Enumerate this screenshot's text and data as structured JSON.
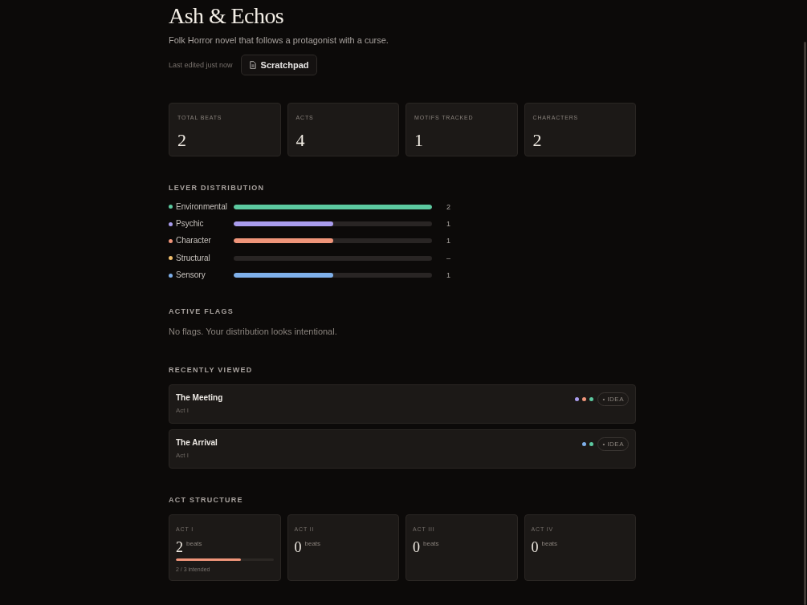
{
  "project": {
    "title": "Ash & Echos",
    "description": "Folk Horror novel that follows a protagonist with a curse.",
    "last_edited": "Last edited just now",
    "scratchpad_button": "Scratchpad"
  },
  "stats": [
    {
      "label": "TOTAL BEATS",
      "value": "2"
    },
    {
      "label": "ACTS",
      "value": "4"
    },
    {
      "label": "MOTIFS TRACKED",
      "value": "1"
    },
    {
      "label": "CHARACTERS",
      "value": "2"
    }
  ],
  "lever_distribution": {
    "heading": "LEVER DISTRIBUTION",
    "levers": [
      {
        "name": "Environmental",
        "color": "#5cc9a0",
        "level": 1,
        "count": "2"
      },
      {
        "name": "Psychic",
        "color": "#a99ced",
        "level": 0.5,
        "count": "1"
      },
      {
        "name": "Character",
        "color": "#f0957a",
        "level": 0.5,
        "count": "1"
      },
      {
        "name": "Structural",
        "color": "#f2c06e",
        "level": 0,
        "count": "–"
      },
      {
        "name": "Sensory",
        "color": "#7fb0ea",
        "level": 0.5,
        "count": "1"
      }
    ]
  },
  "active_flags": {
    "heading": "ACTIVE FLAGS",
    "message": "No flags. Your distribution looks intentional."
  },
  "recently_viewed": {
    "heading": "RECENTLY VIEWED",
    "items": [
      {
        "title": "The Meeting",
        "act": "Act I",
        "levers": [
          {
            "color": "#a99ced"
          },
          {
            "color": "#f0957a"
          },
          {
            "color": "#5cc9a0"
          }
        ],
        "tag": "• IDEA"
      },
      {
        "title": "The Arrival",
        "act": "Act I",
        "levers": [
          {
            "color": "#7fb0ea"
          },
          {
            "color": "#5cc9a0"
          }
        ],
        "tag": "• IDEA"
      }
    ]
  },
  "act_structure": {
    "heading": "ACT STRUCTURE",
    "acts": [
      {
        "label": "ACT I",
        "count": "2",
        "unit": "beats",
        "progress": {
          "level": 0.67,
          "caption": "2 / 3 intended"
        }
      },
      {
        "label": "ACT II",
        "count": "0",
        "unit": "beats"
      },
      {
        "label": "ACT III",
        "count": "0",
        "unit": "beats"
      },
      {
        "label": "ACT IV",
        "count": "0",
        "unit": "beats"
      }
    ]
  }
}
